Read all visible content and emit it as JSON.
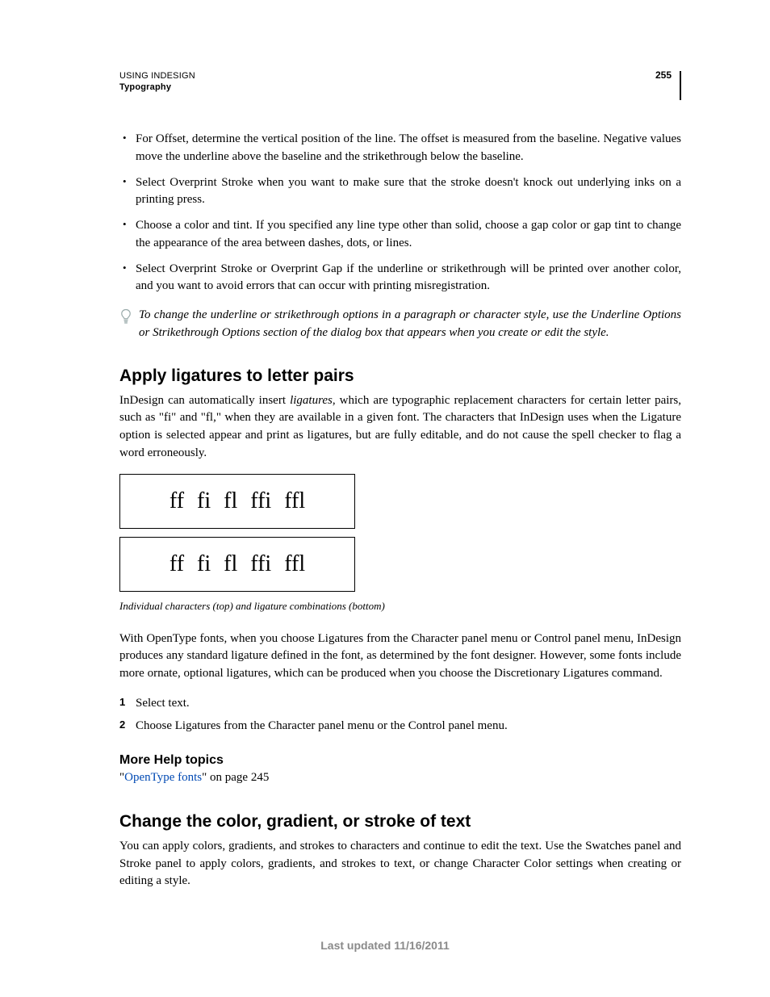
{
  "header": {
    "title": "USING INDESIGN",
    "section": "Typography",
    "page_number": "255"
  },
  "bullets": [
    "For Offset, determine the vertical position of the line. The offset is measured from the baseline. Negative values move the underline above the baseline and the strikethrough below the baseline.",
    "Select Overprint Stroke when you want to make sure that the stroke doesn't knock out underlying inks on a printing press.",
    "Choose a color and tint. If you specified any line type other than solid, choose a gap color or gap tint to change the appearance of the area between dashes, dots, or lines.",
    "Select Overprint Stroke or Overprint Gap if the underline or strikethrough will be printed over another color, and you want to avoid errors that can occur with printing misregistration."
  ],
  "tip": "To change the underline or strikethrough options in a paragraph or character style, use the Underline Options or Strikethrough Options section of the dialog box that appears when you create or edit the style.",
  "section1": {
    "heading": "Apply ligatures to letter pairs",
    "intro_pre": "InDesign can automatically insert ",
    "intro_em": "ligatures",
    "intro_post": ", which are typographic replacement characters for certain letter pairs, such as \"fi\" and \"fl,\" when they are available in a given font. The characters that InDesign uses when the Ligature option is selected appear and print as ligatures, but are fully editable, and do not cause the spell checker to flag a word erroneously.",
    "lig_pairs": [
      "ff",
      "fi",
      "fl",
      "ffi",
      "ffl"
    ],
    "caption": "Individual characters (top) and ligature combinations (bottom)",
    "body2": "With OpenType fonts, when you choose Ligatures from the Character panel menu or Control panel menu, InDesign produces any standard ligature defined in the font, as determined by the font designer. However, some fonts include more ornate, optional ligatures, which can be produced when you choose the Discretionary Ligatures command.",
    "steps": [
      "Select text.",
      "Choose Ligatures from the Character panel menu or the Control panel menu."
    ]
  },
  "more_help": {
    "heading": "More Help topics",
    "quote_open": "\"",
    "link_text": "OpenType fonts",
    "quote_close": "\" on page 245"
  },
  "section2": {
    "heading": "Change the color, gradient, or stroke of text",
    "body": "You can apply colors, gradients, and strokes to characters and continue to edit the text. Use the Swatches panel and Stroke panel to apply colors, gradients, and strokes to text, or change Character Color settings when creating or editing a style."
  },
  "footer": "Last updated 11/16/2011"
}
